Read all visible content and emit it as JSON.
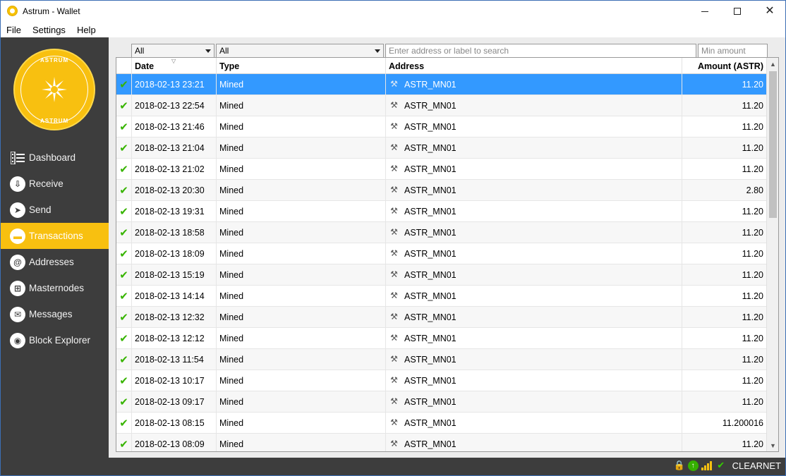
{
  "window": {
    "title": "Astrum - Wallet"
  },
  "menu": {
    "file": "File",
    "settings": "Settings",
    "help": "Help"
  },
  "logo": {
    "text": "ASTRUM",
    "color": "#f8c010"
  },
  "nav": {
    "items": [
      {
        "label": "Dashboard",
        "icon": "dashboard-icon"
      },
      {
        "label": "Receive",
        "icon": "receive-icon"
      },
      {
        "label": "Send",
        "icon": "send-icon"
      },
      {
        "label": "Transactions",
        "icon": "transactions-icon",
        "active": true
      },
      {
        "label": "Addresses",
        "icon": "at-icon"
      },
      {
        "label": "Masternodes",
        "icon": "masternodes-icon"
      },
      {
        "label": "Messages",
        "icon": "messages-icon"
      },
      {
        "label": "Block Explorer",
        "icon": "block-explorer-icon"
      }
    ]
  },
  "filters": {
    "date_value": "All",
    "type_value": "All",
    "search_placeholder": "Enter address or label to search",
    "min_amount_placeholder": "Min amount"
  },
  "table": {
    "headers": {
      "date": "Date",
      "type": "Type",
      "address": "Address",
      "amount": "Amount (ASTR)"
    },
    "rows": [
      {
        "date": "2018-02-13 23:21",
        "type": "Mined",
        "address": "ASTR_MN01",
        "amount": "11.20"
      },
      {
        "date": "2018-02-13 22:54",
        "type": "Mined",
        "address": "ASTR_MN01",
        "amount": "11.20"
      },
      {
        "date": "2018-02-13 21:46",
        "type": "Mined",
        "address": "ASTR_MN01",
        "amount": "11.20"
      },
      {
        "date": "2018-02-13 21:04",
        "type": "Mined",
        "address": "ASTR_MN01",
        "amount": "11.20"
      },
      {
        "date": "2018-02-13 21:02",
        "type": "Mined",
        "address": "ASTR_MN01",
        "amount": "11.20"
      },
      {
        "date": "2018-02-13 20:30",
        "type": "Mined",
        "address": "ASTR_MN01",
        "amount": "2.80"
      },
      {
        "date": "2018-02-13 19:31",
        "type": "Mined",
        "address": "ASTR_MN01",
        "amount": "11.20"
      },
      {
        "date": "2018-02-13 18:58",
        "type": "Mined",
        "address": "ASTR_MN01",
        "amount": "11.20"
      },
      {
        "date": "2018-02-13 18:09",
        "type": "Mined",
        "address": "ASTR_MN01",
        "amount": "11.20"
      },
      {
        "date": "2018-02-13 15:19",
        "type": "Mined",
        "address": "ASTR_MN01",
        "amount": "11.20"
      },
      {
        "date": "2018-02-13 14:14",
        "type": "Mined",
        "address": "ASTR_MN01",
        "amount": "11.20"
      },
      {
        "date": "2018-02-13 12:32",
        "type": "Mined",
        "address": "ASTR_MN01",
        "amount": "11.20"
      },
      {
        "date": "2018-02-13 12:12",
        "type": "Mined",
        "address": "ASTR_MN01",
        "amount": "11.20"
      },
      {
        "date": "2018-02-13 11:54",
        "type": "Mined",
        "address": "ASTR_MN01",
        "amount": "11.20"
      },
      {
        "date": "2018-02-13 10:17",
        "type": "Mined",
        "address": "ASTR_MN01",
        "amount": "11.20"
      },
      {
        "date": "2018-02-13 09:17",
        "type": "Mined",
        "address": "ASTR_MN01",
        "amount": "11.20"
      },
      {
        "date": "2018-02-13 08:15",
        "type": "Mined",
        "address": "ASTR_MN01",
        "amount": "11.200016"
      },
      {
        "date": "2018-02-13 08:09",
        "type": "Mined",
        "address": "ASTR_MN01",
        "amount": "11.20"
      }
    ],
    "selected_row": 0,
    "status_icon": "check-icon",
    "type_icon": "pickaxe-icon"
  },
  "statusbar": {
    "network": "CLEARNET"
  },
  "colors": {
    "accent": "#f8c010",
    "sidebar": "#3d3d3d",
    "selection": "#3399ff",
    "confirmed": "#37b400"
  }
}
